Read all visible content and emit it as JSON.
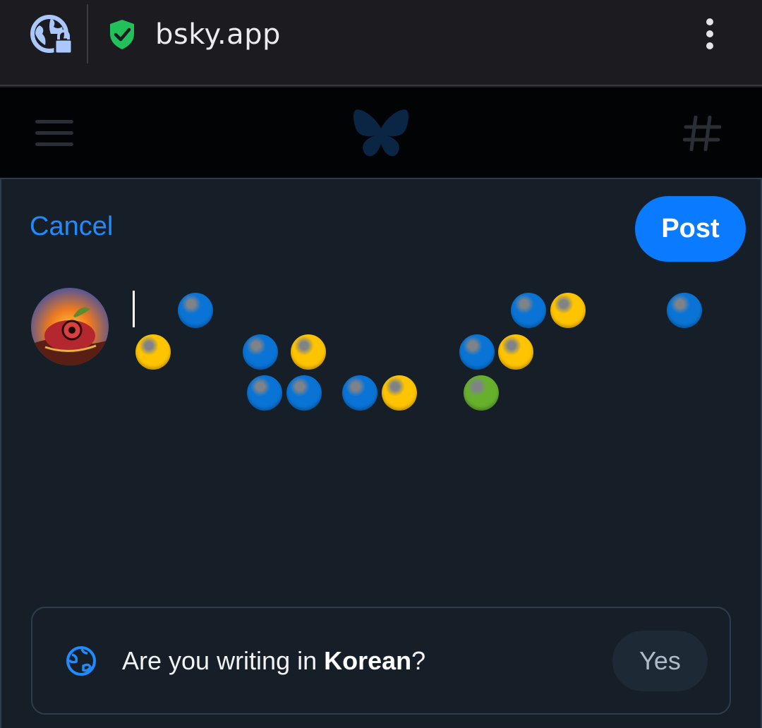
{
  "browser": {
    "url": "bsky.app",
    "site_info_icon": "globe-lock-icon",
    "security_icon": "shield-check-icon",
    "menu_icon": "kebab-menu-icon"
  },
  "app_header": {
    "menu_icon": "hamburger-icon",
    "logo_icon": "bluesky-butterfly-icon",
    "feeds_icon": "hash-icon"
  },
  "composer": {
    "cancel_label": "Cancel",
    "post_label": "Post",
    "avatar_icon": "user-avatar",
    "text_value": "🔵🟡 🔵🟡 🔵🔵 🔵🟡 🔵🟡 🟢 🔵🟡 🔵"
  },
  "language_prompt": {
    "prefix": "Are you writing in ",
    "language": "Korean",
    "suffix": "?",
    "yes_label": "Yes",
    "icon": "globe-icon"
  },
  "colors": {
    "accent": "#0a7aff",
    "link": "#208bfe",
    "background": "#161e27",
    "emoji_blue": "#0a74d6",
    "emoji_yellow": "#ffc400",
    "emoji_green": "#67b02e"
  }
}
